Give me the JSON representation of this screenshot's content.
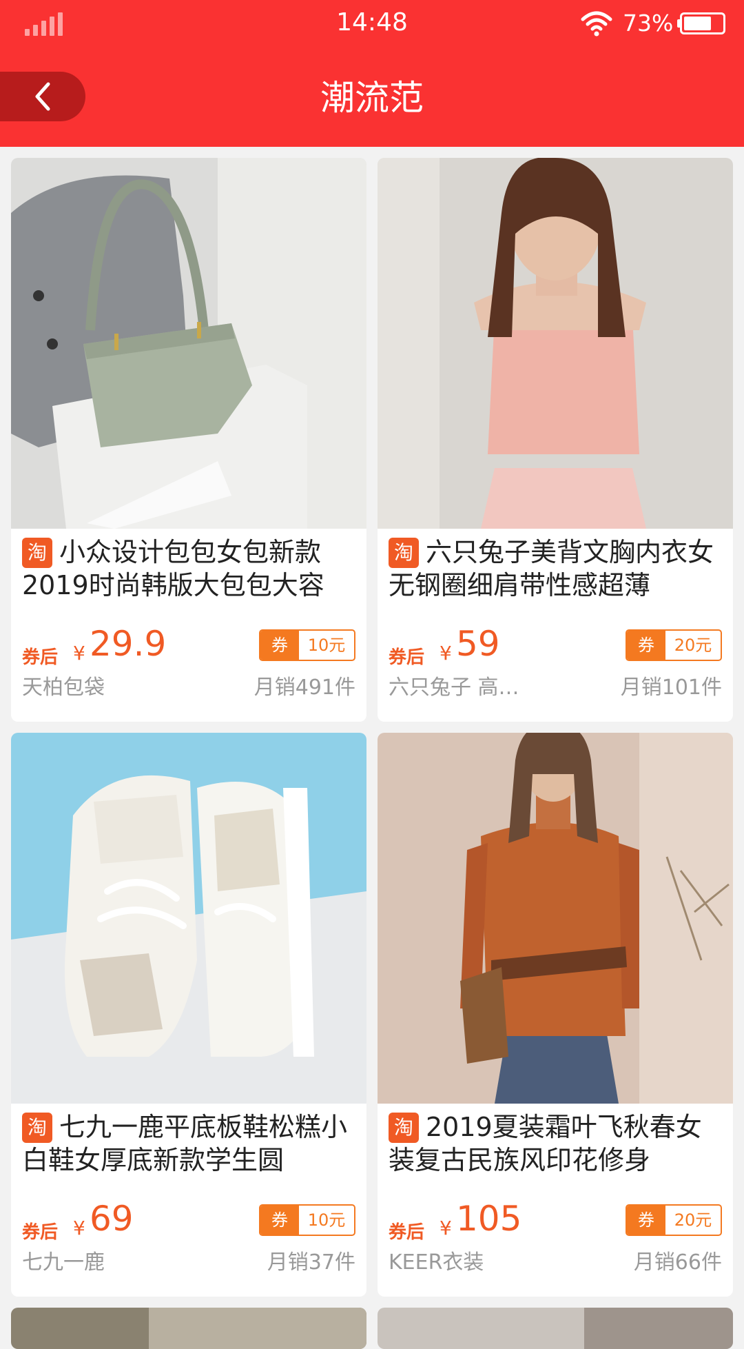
{
  "status_bar": {
    "time": "14:48",
    "battery_percent": "73%",
    "battery_level": 0.73
  },
  "header": {
    "title": "潮流范",
    "back_icon": "chevron-left-icon"
  },
  "colors": {
    "header_red": "#fa3232",
    "accent_orange": "#f05a24",
    "coupon_orange": "#f47920"
  },
  "products": [
    {
      "badge": "淘",
      "title": "小众设计包包女包新款2019时尚韩版大包包大容",
      "price_prefix": "券后",
      "currency": "¥",
      "price": "29.9",
      "coupon_label": "券",
      "coupon_amount": "10元",
      "shop": "天柏包袋",
      "sales": "月销491件"
    },
    {
      "badge": "淘",
      "title": "六只兔子美背文胸内衣女无钢圈细肩带性感超薄",
      "price_prefix": "券后",
      "currency": "¥",
      "price": "59",
      "coupon_label": "券",
      "coupon_amount": "20元",
      "shop": "六只兔子 高…",
      "sales": "月销101件"
    },
    {
      "badge": "淘",
      "title": "七九一鹿平底板鞋松糕小白鞋女厚底新款学生圆",
      "price_prefix": "券后",
      "currency": "¥",
      "price": "69",
      "coupon_label": "券",
      "coupon_amount": "10元",
      "shop": "七九一鹿",
      "sales": "月销37件"
    },
    {
      "badge": "淘",
      "title": "2019夏装霜叶飞秋春女装复古民族风印花修身",
      "price_prefix": "券后",
      "currency": "¥",
      "price": "105",
      "coupon_label": "券",
      "coupon_amount": "20元",
      "shop": "KEER衣装",
      "sales": "月销66件"
    }
  ]
}
